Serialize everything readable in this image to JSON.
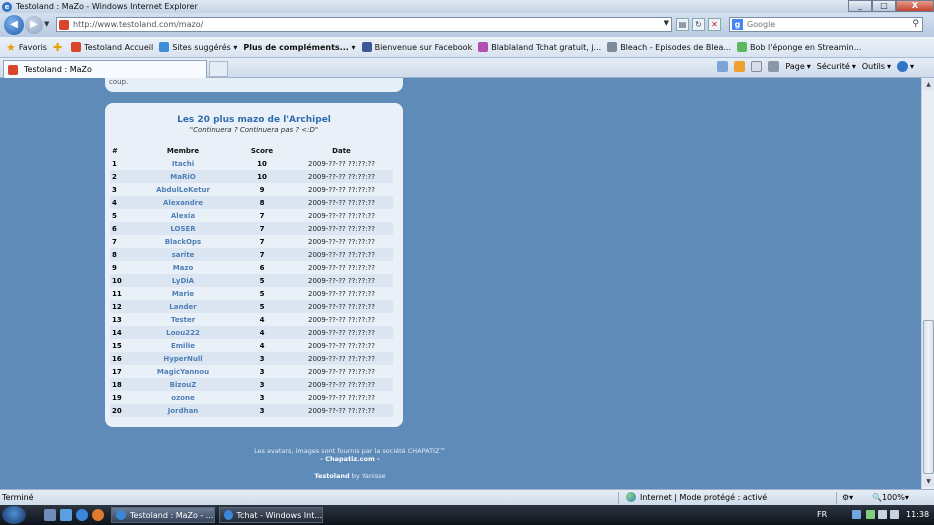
{
  "window": {
    "title": "Testoland : MaZo - Windows Internet Explorer",
    "buttons": {
      "minimize": "_",
      "maximize": "□",
      "close": "X"
    }
  },
  "address": {
    "url": "http://www.testoland.com/mazo/",
    "search_placeholder": "Google"
  },
  "favorites_bar": {
    "favorites_label": "Favoris",
    "items": [
      {
        "label": "Testoland  Accueil"
      },
      {
        "label": "Sites suggérés ▾"
      },
      {
        "label": "Plus de compléments... ▾"
      },
      {
        "label": "Bienvenue sur Facebook"
      },
      {
        "label": "Blablaland Tchat gratuit, j..."
      },
      {
        "label": "Bleach - Episodes de Blea..."
      },
      {
        "label": "Bob l'éponge en Streamin..."
      }
    ]
  },
  "tab": {
    "label": "Testoland : MaZo"
  },
  "commands": {
    "page": "Page",
    "securite": "Sécurité",
    "outils": "Outils"
  },
  "page": {
    "prev_text": "coup.",
    "panel_title": "Les 20 plus mazo de l'Archipel",
    "panel_subtitle": "\"Continuera ? Continuera pas ? <:D\"",
    "columns": [
      "#",
      "Membre",
      "Score",
      "Date"
    ],
    "rows": [
      {
        "n": "1",
        "member": "Itachi",
        "score": "10",
        "date": "2009-??-?? ??:??:??"
      },
      {
        "n": "2",
        "member": "MaRiO",
        "score": "10",
        "date": "2009-??-?? ??:??:??"
      },
      {
        "n": "3",
        "member": "AbdulLeKetur",
        "score": "9",
        "date": "2009-??-?? ??:??:??"
      },
      {
        "n": "4",
        "member": "Alexandre",
        "score": "8",
        "date": "2009-??-?? ??:??:??"
      },
      {
        "n": "5",
        "member": "Alexia",
        "score": "7",
        "date": "2009-??-?? ??:??:??"
      },
      {
        "n": "6",
        "member": "LOSER",
        "score": "7",
        "date": "2009-??-?? ??:??:??"
      },
      {
        "n": "7",
        "member": "BlackOps",
        "score": "7",
        "date": "2009-??-?? ??:??:??"
      },
      {
        "n": "8",
        "member": "sarite",
        "score": "7",
        "date": "2009-??-?? ??:??:??"
      },
      {
        "n": "9",
        "member": "Mazo",
        "score": "6",
        "date": "2009-??-?? ??:??:??"
      },
      {
        "n": "10",
        "member": "LyDiA",
        "score": "5",
        "date": "2009-??-?? ??:??:??"
      },
      {
        "n": "11",
        "member": "Marie",
        "score": "5",
        "date": "2009-??-?? ??:??:??"
      },
      {
        "n": "12",
        "member": "Lander",
        "score": "5",
        "date": "2009-??-?? ??:??:??"
      },
      {
        "n": "13",
        "member": "Tester",
        "score": "4",
        "date": "2009-??-?? ??:??:??"
      },
      {
        "n": "14",
        "member": "Loou222",
        "score": "4",
        "date": "2009-??-?? ??:??:??"
      },
      {
        "n": "15",
        "member": "Emilie",
        "score": "4",
        "date": "2009-??-?? ??:??:??"
      },
      {
        "n": "16",
        "member": "HyperNull",
        "score": "3",
        "date": "2009-??-?? ??:??:??"
      },
      {
        "n": "17",
        "member": "MagicYannou",
        "score": "3",
        "date": "2009-??-?? ??:??:??"
      },
      {
        "n": "18",
        "member": "BizouZ",
        "score": "3",
        "date": "2009-??-?? ??:??:??"
      },
      {
        "n": "19",
        "member": "ozone",
        "score": "3",
        "date": "2009-??-?? ??:??:??"
      },
      {
        "n": "20",
        "member": "Jordhan",
        "score": "3",
        "date": "2009-??-?? ??:??:??"
      }
    ],
    "footer_line1": "Les avatars, images sont fournis par la société CHAPATIZ™",
    "footer_line2": "- Chapatiz.com -",
    "footer_brand": "Testoland",
    "footer_by": "by Yanisse"
  },
  "status": {
    "text": "Terminé",
    "zone": "Internet | Mode protégé : activé",
    "zoom": "100%"
  },
  "taskbar": {
    "tasks": [
      {
        "label": "Testoland : MaZo - ..."
      },
      {
        "label": "Tchat - Windows Int..."
      }
    ],
    "lang": "FR",
    "clock": "11:38"
  },
  "colors": {
    "page_bg": "#5f8bb8",
    "panel_bg": "#e9f0f8",
    "member_link": "#4f7fb5",
    "title_blue": "#2f6cae"
  }
}
